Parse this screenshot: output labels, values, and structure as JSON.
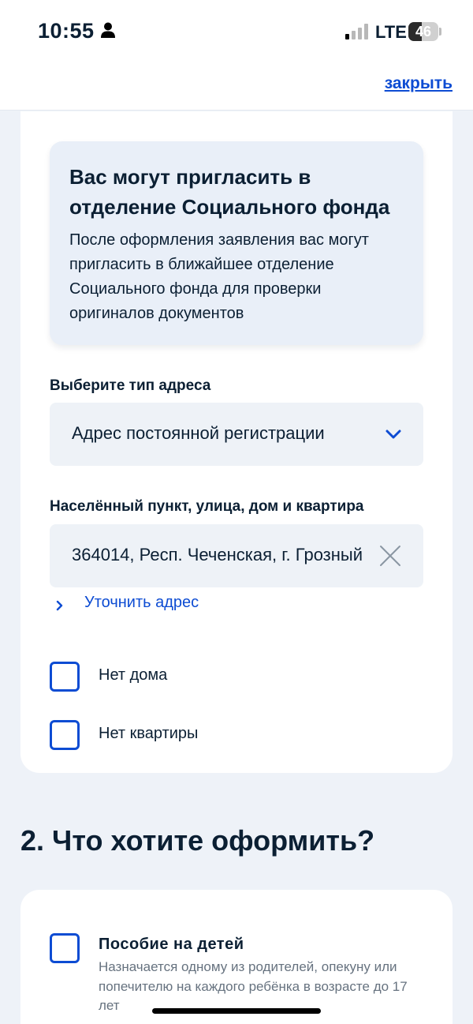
{
  "status_bar": {
    "time": "10:55",
    "network": "LTE",
    "battery": "46",
    "battery_level": 0.46
  },
  "header": {
    "close_label": "закрыть"
  },
  "info_box": {
    "title": "Вас могут пригласить в отделение Социального фонда",
    "text": "После оформления заявления вас могут пригласить в ближайшее отделение Социального фонда для проверки оригиналов документов"
  },
  "address_type": {
    "label": "Выберите тип адреса",
    "value": "Адрес постоянной регистрации"
  },
  "address": {
    "label": "Населённый пункт, улица, дом и квартира",
    "value": "364014, Респ. Чеченская, г. Грозный",
    "refine_label": "Уточнить адрес"
  },
  "checkboxes": {
    "no_house": "Нет дома",
    "no_apartment": "Нет квартиры"
  },
  "section2": {
    "title": "2. Что хотите оформить?",
    "benefit_title": "Пособие на детей",
    "benefit_desc": "Назначается одному из родителей, опекуну или попечителю на каждого ребёнка в возрасте до 17 лет"
  },
  "colors": {
    "accent": "#0d4cd3",
    "text": "#0b1f33",
    "background": "#eef2f8",
    "info_box": "#e9eff8",
    "field": "#eef2f7"
  }
}
